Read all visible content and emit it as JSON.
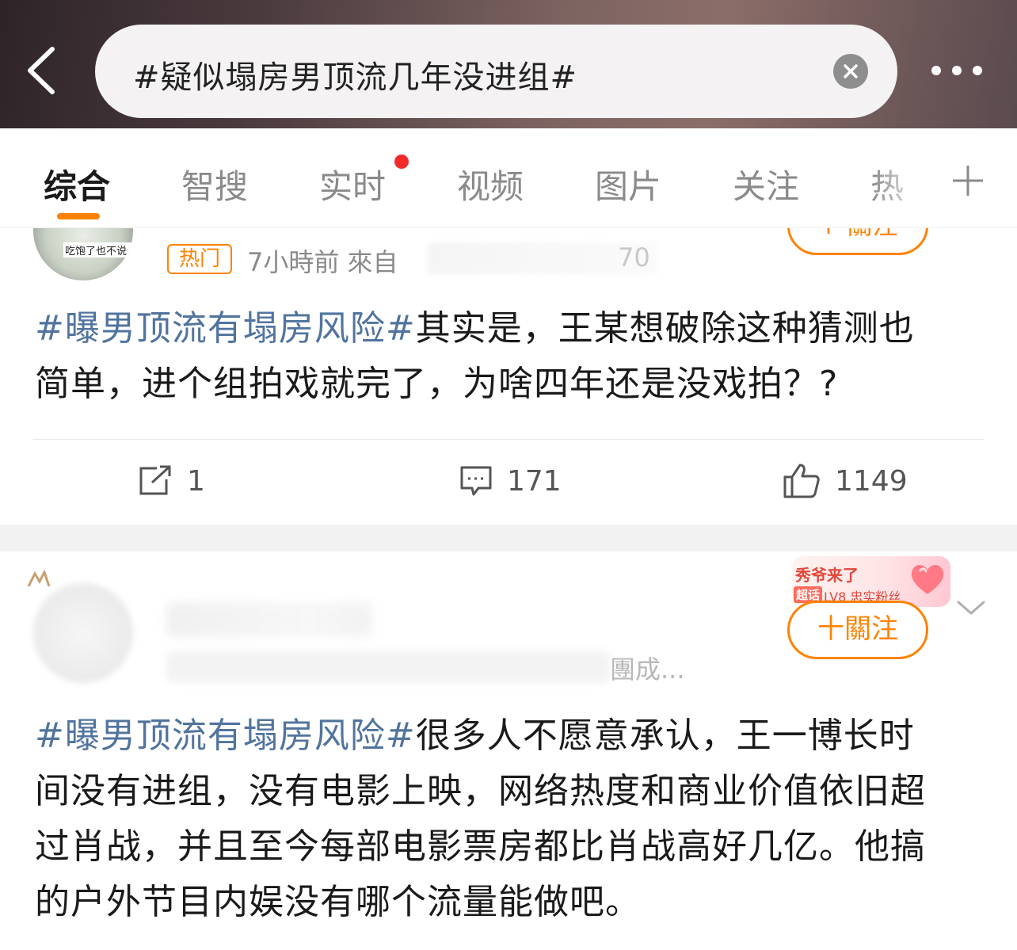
{
  "search": {
    "query": "#疑似塌房男顶流几年没进组#"
  },
  "tabs": [
    {
      "label": "综合",
      "active": true
    },
    {
      "label": "智搜",
      "active": false
    },
    {
      "label": "实时",
      "active": false,
      "has_dot": true
    },
    {
      "label": "视频",
      "active": false
    },
    {
      "label": "图片",
      "active": false
    },
    {
      "label": "关注",
      "active": false
    },
    {
      "label": "热",
      "active": false
    }
  ],
  "colors": {
    "accent": "#ff8200",
    "hashtag": "#51749e",
    "red_dot": "#f42a2a"
  },
  "posts": [
    {
      "avatar_sticker": "吃饱了也不说 一直",
      "follow_label": "+ 關注",
      "hot_badge": "热门",
      "meta": "7小時前  來自",
      "meta_tail": "70",
      "hashtag": "#曝男顶流有塌房风险#",
      "text_line1_rest": "其实是，王某想破除这种猜测也",
      "text_line2": "简单，进个组拍戏就完了，为啥四年还是没戏拍？?",
      "reposts": "1",
      "comments": "171",
      "likes": "1149"
    },
    {
      "fan_badge_title": "秀爷来了",
      "fan_badge_chip": "超话",
      "fan_badge_level": "LV8 忠实粉丝",
      "follow_label": "十關注",
      "meta_tail": "團成...",
      "hashtag": "#曝男顶流有塌房风险#",
      "text_line1_rest": "很多人不愿意承认，王一博长时",
      "text_line2": "间没有进组，没有电影上映，网络热度和商业价值依旧超",
      "text_line3": "过肖战，并且至今每部电影票房都比肖战高好几亿。他搞",
      "text_line4": "的户外节目内娱没有哪个流量能做吧。"
    }
  ]
}
